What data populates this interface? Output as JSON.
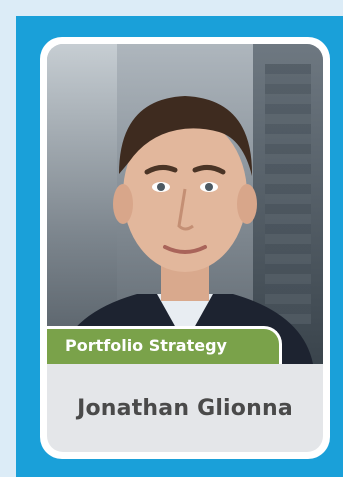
{
  "profile": {
    "category": "Portfolio Strategy",
    "name": "Jonathan Glionna"
  },
  "colors": {
    "outer_background": "#dcecf7",
    "panel_blue": "#1aa0d9",
    "tag_green": "#7aa24a",
    "name_plate_gray": "#e4e6e9",
    "name_text": "#4a4a4a"
  },
  "icons": {
    "photo": "person-portrait"
  }
}
